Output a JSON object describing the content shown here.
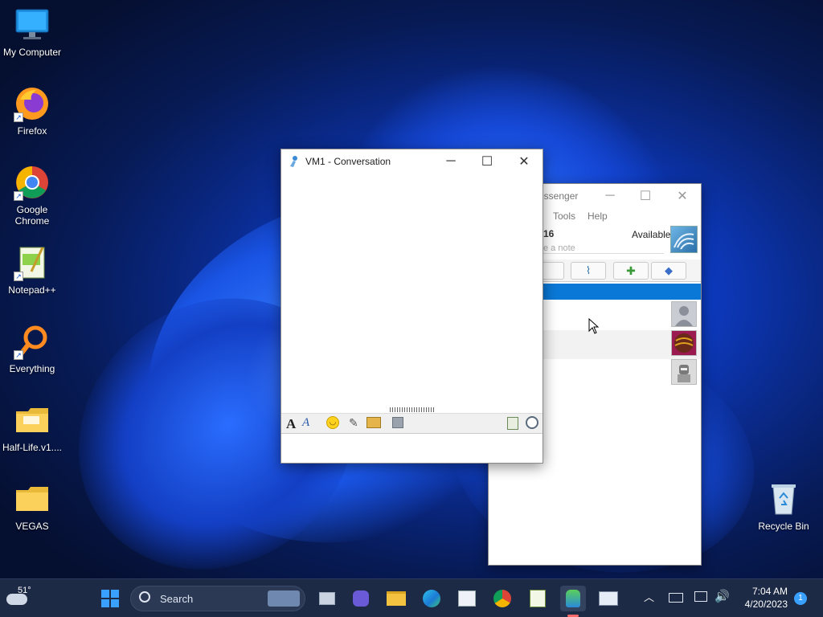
{
  "desktop": {
    "icons": [
      {
        "label": "My Computer"
      },
      {
        "label": "Firefox"
      },
      {
        "label": "Google Chrome"
      },
      {
        "label": "Notepad++"
      },
      {
        "label": "Everything"
      },
      {
        "label": "Half-Life.v1...."
      },
      {
        "label": "VEGAS"
      },
      {
        "label": "Recycle Bin"
      }
    ]
  },
  "conversation": {
    "title": "VM1 - Conversation",
    "toolbar_icons": [
      "font-icon",
      "font-style-icon",
      "emoticon-icon",
      "nudge-icon",
      "send-file-icon",
      "save-icon",
      "paste-icon",
      "history-icon"
    ]
  },
  "messenger": {
    "title_partial": "essenger",
    "menu": [
      "Tools",
      "Help"
    ],
    "user_fragment": "16",
    "status": "Available",
    "note_placeholder": "e a note",
    "toolbar_icons": [
      "contacts-icon",
      "rss-icon",
      "add-contact-icon",
      "groups-icon"
    ]
  },
  "taskbar": {
    "weather_temp": "51°",
    "search_placeholder": "Search",
    "time": "7:04 AM",
    "date": "4/20/2023",
    "notification_count": "1"
  }
}
